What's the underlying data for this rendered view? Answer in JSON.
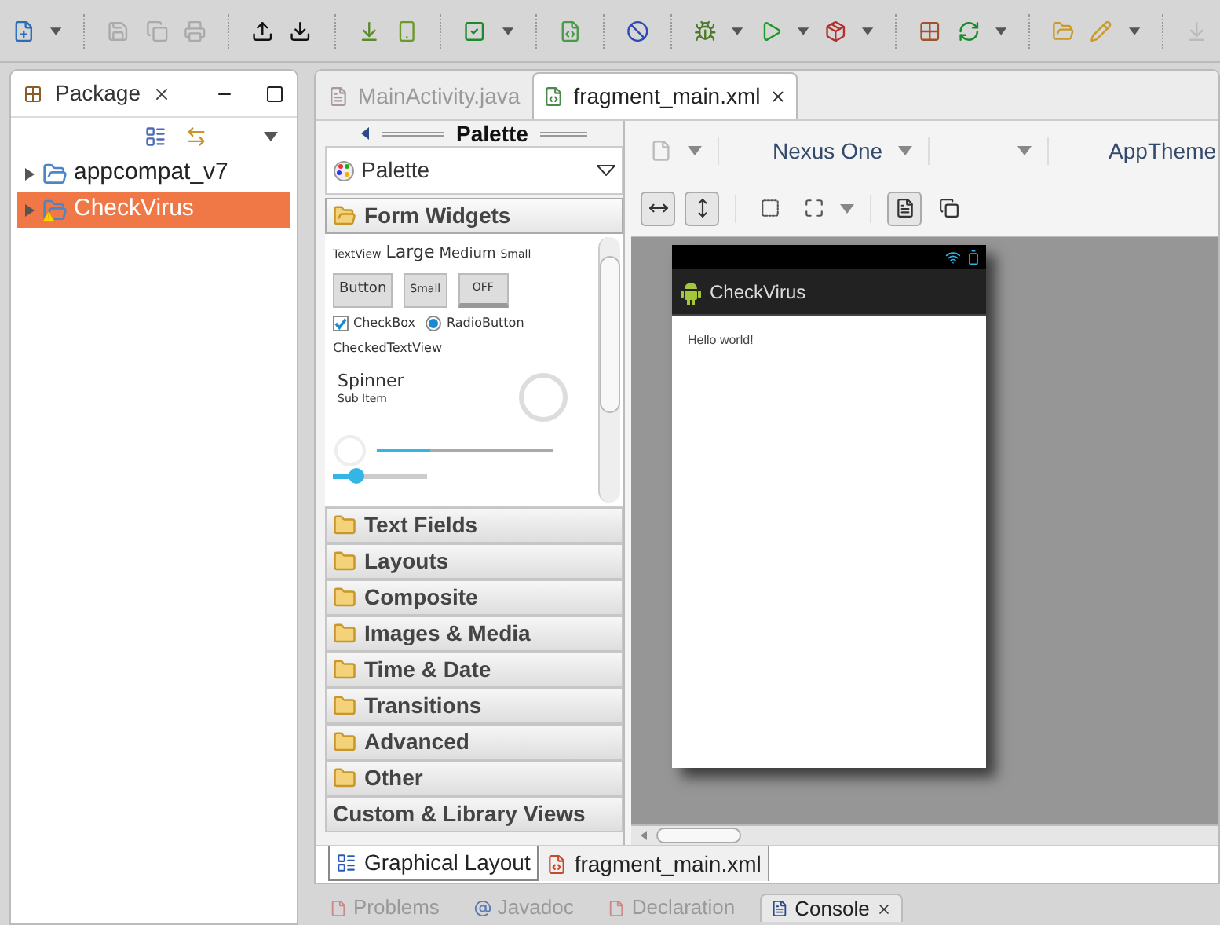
{
  "package_explorer": {
    "tab": {
      "label": "Package"
    },
    "tree": [
      {
        "label": "appcompat_v7",
        "selected": false,
        "expanded": false,
        "warning": false
      },
      {
        "label": "CheckVirus",
        "selected": true,
        "expanded": false,
        "warning": true
      }
    ]
  },
  "editor": {
    "tabs": [
      {
        "label": "MainActivity.java",
        "selected": false,
        "kind": "java"
      },
      {
        "label": "fragment_main.xml",
        "selected": true,
        "kind": "xml"
      }
    ],
    "palette": {
      "title": "Palette",
      "dropdown": "Palette",
      "form_widgets": {
        "textviews": [
          "TextView",
          "Large",
          "Medium",
          "Small"
        ],
        "buttons": [
          "Button",
          "Small",
          "OFF"
        ],
        "checkbox": {
          "label": "CheckBox",
          "checked": true
        },
        "radio": {
          "label": "RadioButton",
          "selected": true
        },
        "checked_text_view": "CheckedTextView",
        "spinner": {
          "label": "Spinner",
          "sub_item": "Sub Item"
        },
        "progress": {
          "level": 0.3
        },
        "seek_bar": {
          "level": 0.25
        }
      },
      "categories": [
        {
          "label": "Form Widgets",
          "expanded": true,
          "kind": "folder"
        },
        {
          "label": "Text Fields",
          "expanded": false,
          "kind": "folder"
        },
        {
          "label": "Layouts",
          "expanded": false,
          "kind": "folder"
        },
        {
          "label": "Composite",
          "expanded": false,
          "kind": "folder"
        },
        {
          "label": "Images & Media",
          "expanded": false,
          "kind": "folder"
        },
        {
          "label": "Time & Date",
          "expanded": false,
          "kind": "folder"
        },
        {
          "label": "Transitions",
          "expanded": false,
          "kind": "folder"
        },
        {
          "label": "Advanced",
          "expanded": false,
          "kind": "folder"
        },
        {
          "label": "Other",
          "expanded": false,
          "kind": "folder"
        },
        {
          "label": "Custom & Library Views",
          "expanded": false,
          "kind": "plain"
        }
      ]
    },
    "canvas": {
      "device": "Nexus One",
      "theme": "AppTheme",
      "app_title": "CheckVirus",
      "content": "Hello world!"
    },
    "bottom_tabs": [
      {
        "label": "Graphical Layout",
        "selected": true
      },
      {
        "label": "fragment_main.xml",
        "selected": false
      }
    ]
  },
  "lower_panel": {
    "tabs": [
      {
        "label": "Problems",
        "selected": false
      },
      {
        "label": "Javadoc",
        "selected": false
      },
      {
        "label": "Declaration",
        "selected": false
      },
      {
        "label": "Console",
        "selected": true
      }
    ]
  }
}
